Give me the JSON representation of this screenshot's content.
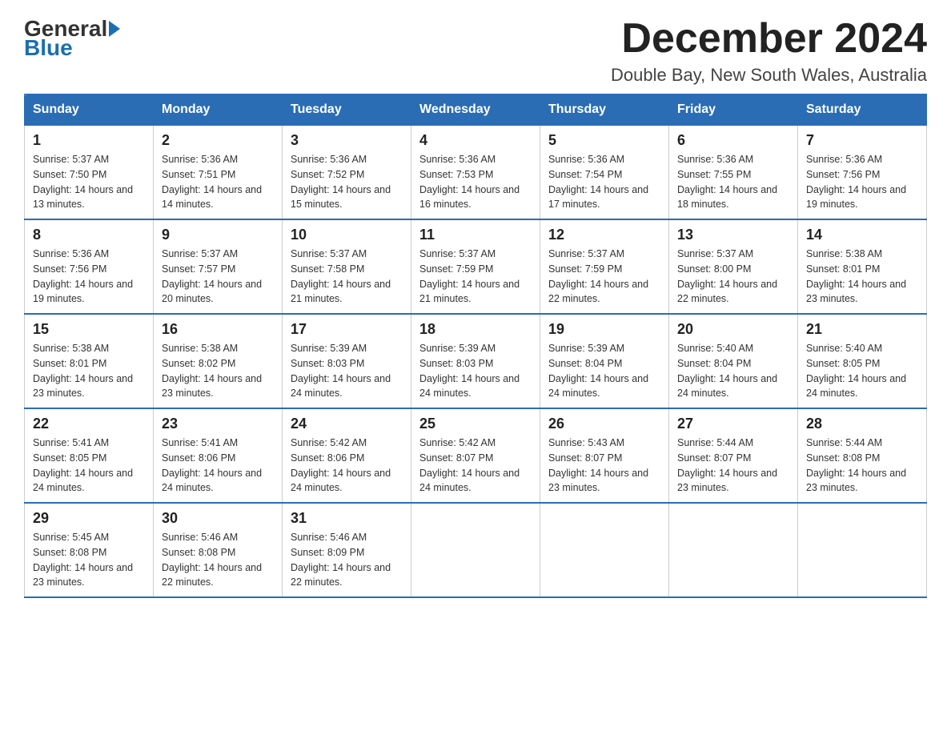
{
  "logo": {
    "part1": "General",
    "part2": "Blue"
  },
  "title": "December 2024",
  "location": "Double Bay, New South Wales, Australia",
  "days_of_week": [
    "Sunday",
    "Monday",
    "Tuesday",
    "Wednesday",
    "Thursday",
    "Friday",
    "Saturday"
  ],
  "weeks": [
    [
      {
        "day": "1",
        "sunrise": "5:37 AM",
        "sunset": "7:50 PM",
        "daylight": "14 hours and 13 minutes."
      },
      {
        "day": "2",
        "sunrise": "5:36 AM",
        "sunset": "7:51 PM",
        "daylight": "14 hours and 14 minutes."
      },
      {
        "day": "3",
        "sunrise": "5:36 AM",
        "sunset": "7:52 PM",
        "daylight": "14 hours and 15 minutes."
      },
      {
        "day": "4",
        "sunrise": "5:36 AM",
        "sunset": "7:53 PM",
        "daylight": "14 hours and 16 minutes."
      },
      {
        "day": "5",
        "sunrise": "5:36 AM",
        "sunset": "7:54 PM",
        "daylight": "14 hours and 17 minutes."
      },
      {
        "day": "6",
        "sunrise": "5:36 AM",
        "sunset": "7:55 PM",
        "daylight": "14 hours and 18 minutes."
      },
      {
        "day": "7",
        "sunrise": "5:36 AM",
        "sunset": "7:56 PM",
        "daylight": "14 hours and 19 minutes."
      }
    ],
    [
      {
        "day": "8",
        "sunrise": "5:36 AM",
        "sunset": "7:56 PM",
        "daylight": "14 hours and 19 minutes."
      },
      {
        "day": "9",
        "sunrise": "5:37 AM",
        "sunset": "7:57 PM",
        "daylight": "14 hours and 20 minutes."
      },
      {
        "day": "10",
        "sunrise": "5:37 AM",
        "sunset": "7:58 PM",
        "daylight": "14 hours and 21 minutes."
      },
      {
        "day": "11",
        "sunrise": "5:37 AM",
        "sunset": "7:59 PM",
        "daylight": "14 hours and 21 minutes."
      },
      {
        "day": "12",
        "sunrise": "5:37 AM",
        "sunset": "7:59 PM",
        "daylight": "14 hours and 22 minutes."
      },
      {
        "day": "13",
        "sunrise": "5:37 AM",
        "sunset": "8:00 PM",
        "daylight": "14 hours and 22 minutes."
      },
      {
        "day": "14",
        "sunrise": "5:38 AM",
        "sunset": "8:01 PM",
        "daylight": "14 hours and 23 minutes."
      }
    ],
    [
      {
        "day": "15",
        "sunrise": "5:38 AM",
        "sunset": "8:01 PM",
        "daylight": "14 hours and 23 minutes."
      },
      {
        "day": "16",
        "sunrise": "5:38 AM",
        "sunset": "8:02 PM",
        "daylight": "14 hours and 23 minutes."
      },
      {
        "day": "17",
        "sunrise": "5:39 AM",
        "sunset": "8:03 PM",
        "daylight": "14 hours and 24 minutes."
      },
      {
        "day": "18",
        "sunrise": "5:39 AM",
        "sunset": "8:03 PM",
        "daylight": "14 hours and 24 minutes."
      },
      {
        "day": "19",
        "sunrise": "5:39 AM",
        "sunset": "8:04 PM",
        "daylight": "14 hours and 24 minutes."
      },
      {
        "day": "20",
        "sunrise": "5:40 AM",
        "sunset": "8:04 PM",
        "daylight": "14 hours and 24 minutes."
      },
      {
        "day": "21",
        "sunrise": "5:40 AM",
        "sunset": "8:05 PM",
        "daylight": "14 hours and 24 minutes."
      }
    ],
    [
      {
        "day": "22",
        "sunrise": "5:41 AM",
        "sunset": "8:05 PM",
        "daylight": "14 hours and 24 minutes."
      },
      {
        "day": "23",
        "sunrise": "5:41 AM",
        "sunset": "8:06 PM",
        "daylight": "14 hours and 24 minutes."
      },
      {
        "day": "24",
        "sunrise": "5:42 AM",
        "sunset": "8:06 PM",
        "daylight": "14 hours and 24 minutes."
      },
      {
        "day": "25",
        "sunrise": "5:42 AM",
        "sunset": "8:07 PM",
        "daylight": "14 hours and 24 minutes."
      },
      {
        "day": "26",
        "sunrise": "5:43 AM",
        "sunset": "8:07 PM",
        "daylight": "14 hours and 23 minutes."
      },
      {
        "day": "27",
        "sunrise": "5:44 AM",
        "sunset": "8:07 PM",
        "daylight": "14 hours and 23 minutes."
      },
      {
        "day": "28",
        "sunrise": "5:44 AM",
        "sunset": "8:08 PM",
        "daylight": "14 hours and 23 minutes."
      }
    ],
    [
      {
        "day": "29",
        "sunrise": "5:45 AM",
        "sunset": "8:08 PM",
        "daylight": "14 hours and 23 minutes."
      },
      {
        "day": "30",
        "sunrise": "5:46 AM",
        "sunset": "8:08 PM",
        "daylight": "14 hours and 22 minutes."
      },
      {
        "day": "31",
        "sunrise": "5:46 AM",
        "sunset": "8:09 PM",
        "daylight": "14 hours and 22 minutes."
      },
      null,
      null,
      null,
      null
    ]
  ]
}
